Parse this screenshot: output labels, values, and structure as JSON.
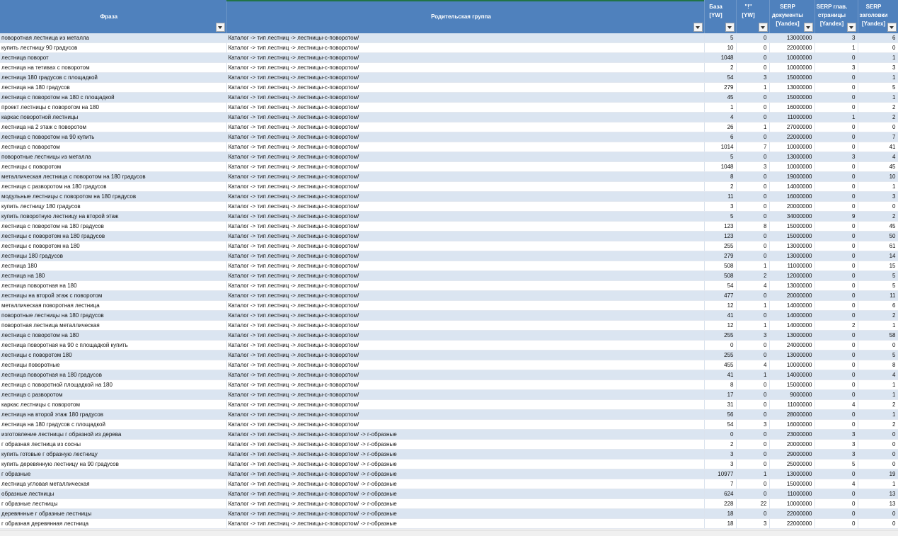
{
  "headers": [
    {
      "label": "Фраза"
    },
    {
      "label": "Родительская группа"
    },
    {
      "label": "База [YW]"
    },
    {
      "label": "\"!\" [YW]"
    },
    {
      "label": "SERP документы [Yandex]"
    },
    {
      "label": "SERP глав. страницы [Yandex]"
    },
    {
      "label": "SERP заголовки [Yandex]"
    }
  ],
  "rows": [
    [
      "поворотная лестница из металла",
      "Каталог -> тип лестниц -> лестницы-с-поворотом/",
      "5",
      "0",
      "13000000",
      "3",
      "6"
    ],
    [
      "купить лестницу 90 градусов",
      "Каталог -> тип лестниц -> лестницы-с-поворотом/",
      "10",
      "0",
      "22000000",
      "1",
      "0"
    ],
    [
      "лестница поворот",
      "Каталог -> тип лестниц -> лестницы-с-поворотом/",
      "1048",
      "0",
      "10000000",
      "0",
      "1"
    ],
    [
      "лестница на тетивах с поворотом",
      "Каталог -> тип лестниц -> лестницы-с-поворотом/",
      "2",
      "0",
      "10000000",
      "3",
      "3"
    ],
    [
      "лестница 180 градусов с площадкой",
      "Каталог -> тип лестниц -> лестницы-с-поворотом/",
      "54",
      "3",
      "15000000",
      "0",
      "1"
    ],
    [
      "лестница на 180 градусов",
      "Каталог -> тип лестниц -> лестницы-с-поворотом/",
      "279",
      "1",
      "13000000",
      "0",
      "5"
    ],
    [
      "лестница с поворотом на 180 с площадкой",
      "Каталог -> тип лестниц -> лестницы-с-поворотом/",
      "45",
      "0",
      "15000000",
      "0",
      "1"
    ],
    [
      "проект лестницы с поворотом на 180",
      "Каталог -> тип лестниц -> лестницы-с-поворотом/",
      "1",
      "0",
      "16000000",
      "0",
      "2"
    ],
    [
      "каркас поворотной лестницы",
      "Каталог -> тип лестниц -> лестницы-с-поворотом/",
      "4",
      "0",
      "11000000",
      "1",
      "2"
    ],
    [
      "лестница на 2 этаж с поворотом",
      "Каталог -> тип лестниц -> лестницы-с-поворотом/",
      "26",
      "1",
      "27000000",
      "0",
      "0"
    ],
    [
      "лестница с поворотом на 90 купить",
      "Каталог -> тип лестниц -> лестницы-с-поворотом/",
      "6",
      "0",
      "22000000",
      "0",
      "7"
    ],
    [
      "лестница с поворотом",
      "Каталог -> тип лестниц -> лестницы-с-поворотом/",
      "1014",
      "7",
      "10000000",
      "0",
      "41"
    ],
    [
      "поворотные лестницы из металла",
      "Каталог -> тип лестниц -> лестницы-с-поворотом/",
      "5",
      "0",
      "13000000",
      "3",
      "4"
    ],
    [
      "лестницы с поворотом",
      "Каталог -> тип лестниц -> лестницы-с-поворотом/",
      "1048",
      "3",
      "10000000",
      "0",
      "45"
    ],
    [
      "металлическая лестница с поворотом на 180 градусов",
      "Каталог -> тип лестниц -> лестницы-с-поворотом/",
      "8",
      "0",
      "19000000",
      "0",
      "10"
    ],
    [
      "лестница с разворотом на 180 градусов",
      "Каталог -> тип лестниц -> лестницы-с-поворотом/",
      "2",
      "0",
      "14000000",
      "0",
      "1"
    ],
    [
      "модульные лестницы с поворотом на 180 градусов",
      "Каталог -> тип лестниц -> лестницы-с-поворотом/",
      "11",
      "0",
      "16000000",
      "0",
      "3"
    ],
    [
      "купить лестницу 180 градусов",
      "Каталог -> тип лестниц -> лестницы-с-поворотом/",
      "3",
      "0",
      "20000000",
      "0",
      "0"
    ],
    [
      "купить поворотную лестницу на второй этаж",
      "Каталог -> тип лестниц -> лестницы-с-поворотом/",
      "5",
      "0",
      "34000000",
      "9",
      "2"
    ],
    [
      "лестница с поворотом на 180 градусов",
      "Каталог -> тип лестниц -> лестницы-с-поворотом/",
      "123",
      "8",
      "15000000",
      "0",
      "45"
    ],
    [
      "лестницы с поворотом на 180 градусов",
      "Каталог -> тип лестниц -> лестницы-с-поворотом/",
      "123",
      "0",
      "15000000",
      "0",
      "50"
    ],
    [
      "лестницы с поворотом на 180",
      "Каталог -> тип лестниц -> лестницы-с-поворотом/",
      "255",
      "0",
      "13000000",
      "0",
      "61"
    ],
    [
      "лестницы 180 градусов",
      "Каталог -> тип лестниц -> лестницы-с-поворотом/",
      "279",
      "0",
      "13000000",
      "0",
      "14"
    ],
    [
      "лестница 180",
      "Каталог -> тип лестниц -> лестницы-с-поворотом/",
      "508",
      "1",
      "11000000",
      "0",
      "15"
    ],
    [
      "лестница на 180",
      "Каталог -> тип лестниц -> лестницы-с-поворотом/",
      "508",
      "2",
      "12000000",
      "0",
      "5"
    ],
    [
      "лестница поворотная на 180",
      "Каталог -> тип лестниц -> лестницы-с-поворотом/",
      "54",
      "4",
      "13000000",
      "0",
      "5"
    ],
    [
      "лестницы на второй этаж с поворотом",
      "Каталог -> тип лестниц -> лестницы-с-поворотом/",
      "477",
      "0",
      "20000000",
      "0",
      "11"
    ],
    [
      "металлическая поворотная лестница",
      "Каталог -> тип лестниц -> лестницы-с-поворотом/",
      "12",
      "1",
      "14000000",
      "0",
      "6"
    ],
    [
      "поворотные лестницы на 180 градусов",
      "Каталог -> тип лестниц -> лестницы-с-поворотом/",
      "41",
      "0",
      "14000000",
      "0",
      "2"
    ],
    [
      "поворотная лестница металлическая",
      "Каталог -> тип лестниц -> лестницы-с-поворотом/",
      "12",
      "1",
      "14000000",
      "2",
      "1"
    ],
    [
      "лестница с поворотом на 180",
      "Каталог -> тип лестниц -> лестницы-с-поворотом/",
      "255",
      "3",
      "13000000",
      "0",
      "58"
    ],
    [
      "лестница поворотная на 90 с площадкой купить",
      "Каталог -> тип лестниц -> лестницы-с-поворотом/",
      "0",
      "0",
      "24000000",
      "0",
      "0"
    ],
    [
      "лестницы с поворотом 180",
      "Каталог -> тип лестниц -> лестницы-с-поворотом/",
      "255",
      "0",
      "13000000",
      "0",
      "5"
    ],
    [
      "лестницы поворотные",
      "Каталог -> тип лестниц -> лестницы-с-поворотом/",
      "455",
      "4",
      "10000000",
      "0",
      "8"
    ],
    [
      "лестница поворотная на 180 градусов",
      "Каталог -> тип лестниц -> лестницы-с-поворотом/",
      "41",
      "1",
      "14000000",
      "0",
      "4"
    ],
    [
      "лестница с поворотной площадкой на 180",
      "Каталог -> тип лестниц -> лестницы-с-поворотом/",
      "8",
      "0",
      "15000000",
      "0",
      "1"
    ],
    [
      "лестница с разворотом",
      "Каталог -> тип лестниц -> лестницы-с-поворотом/",
      "17",
      "0",
      "9000000",
      "0",
      "1"
    ],
    [
      "каркас лестницы с поворотом",
      "Каталог -> тип лестниц -> лестницы-с-поворотом/",
      "31",
      "0",
      "11000000",
      "4",
      "2"
    ],
    [
      "лестница на второй этаж 180 градусов",
      "Каталог -> тип лестниц -> лестницы-с-поворотом/",
      "56",
      "0",
      "28000000",
      "0",
      "1"
    ],
    [
      "лестница на 180 градусов с площадкой",
      "Каталог -> тип лестниц -> лестницы-с-поворотом/",
      "54",
      "3",
      "16000000",
      "0",
      "2"
    ],
    [
      "изготовление лестницы г образной из дерева",
      "Каталог -> тип лестниц -> лестницы-с-поворотом/ -> г-образные",
      "0",
      "0",
      "23000000",
      "3",
      "0"
    ],
    [
      "г образная лестница из сосны",
      "Каталог -> тип лестниц -> лестницы-с-поворотом/ -> г-образные",
      "2",
      "0",
      "20000000",
      "3",
      "0"
    ],
    [
      "купить готовые г образную лестницу",
      "Каталог -> тип лестниц -> лестницы-с-поворотом/ -> г-образные",
      "3",
      "0",
      "29000000",
      "3",
      "0"
    ],
    [
      "купить деревянную лестницу на 90 градусов",
      "Каталог -> тип лестниц -> лестницы-с-поворотом/ -> г-образные",
      "3",
      "0",
      "25000000",
      "5",
      "0"
    ],
    [
      "г образные",
      "Каталог -> тип лестниц -> лестницы-с-поворотом/ -> г-образные",
      "10977",
      "1",
      "13000000",
      "0",
      "19"
    ],
    [
      "лестница угловая металлическая",
      "Каталог -> тип лестниц -> лестницы-с-поворотом/ -> г-образные",
      "7",
      "0",
      "15000000",
      "4",
      "1"
    ],
    [
      "образные лестницы",
      "Каталог -> тип лестниц -> лестницы-с-поворотом/ -> г-образные",
      "624",
      "0",
      "11000000",
      "0",
      "13"
    ],
    [
      "г образные лестницы",
      "Каталог -> тип лестниц -> лестницы-с-поворотом/ -> г-образные",
      "228",
      "22",
      "10000000",
      "0",
      "13"
    ],
    [
      "деревянные г образные лестницы",
      "Каталог -> тип лестниц -> лестницы-с-поворотом/ -> г-образные",
      "18",
      "0",
      "22000000",
      "0",
      "0"
    ],
    [
      "г образная деревянная лестница",
      "Каталог -> тип лестниц -> лестницы-с-поворотом/ -> г-образные",
      "18",
      "3",
      "22000000",
      "0",
      "0"
    ]
  ],
  "colors": {
    "header_bg": "#4f81bd",
    "band_row": "#dbe5f1",
    "active_column_accent": "#217346"
  },
  "icons": {
    "filter": "dropdown-arrow-icon"
  }
}
